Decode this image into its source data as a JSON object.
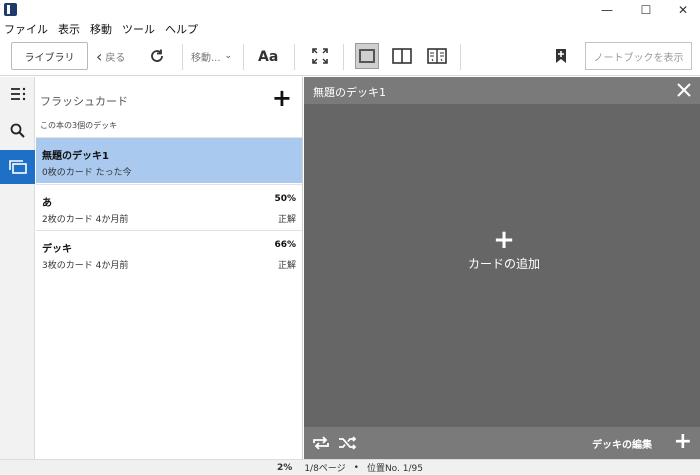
{
  "menu": [
    "ファイル",
    "表示",
    "移動",
    "ツール",
    "ヘルプ"
  ],
  "window_controls": {
    "minimize": "—",
    "maximize": "☐",
    "close": "✕"
  },
  "toolbar": {
    "library_label": "ライブラリ",
    "back_label": "戻る",
    "move_label": "移動...",
    "font_label": "Aa",
    "notebook_label": "ノートブックを表示"
  },
  "flashcards": {
    "title": "フラッシュカード",
    "subtitle": "この本の3個のデッキ",
    "decks": [
      {
        "name": "無題のデッキ1",
        "meta": "0枚のカード たった今",
        "percent": "",
        "result": "",
        "selected": true
      },
      {
        "name": "あ",
        "meta": "2枚のカード 4か月前",
        "percent": "50%",
        "result": "正解",
        "selected": false
      },
      {
        "name": "デッキ",
        "meta": "3枚のカード 4か月前",
        "percent": "66%",
        "result": "正解",
        "selected": false
      }
    ]
  },
  "deck_view": {
    "title": "無題のデッキ1",
    "add_card_label": "カードの追加",
    "edit_deck_label": "デッキの編集"
  },
  "status": {
    "percent": "2%",
    "page": "1/8ページ",
    "separator": "•",
    "location": "位置No. 1/95"
  }
}
